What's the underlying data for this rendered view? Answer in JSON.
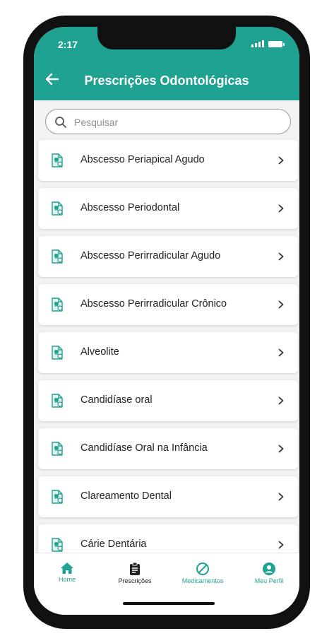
{
  "status_bar": {
    "time": "2:17"
  },
  "header": {
    "title": "Prescrições Odontológicas",
    "back_icon": "arrow-left-icon"
  },
  "search": {
    "placeholder": "Pesquisar",
    "value": ""
  },
  "items": [
    {
      "label": "Abscesso Periapical Agudo"
    },
    {
      "label": "Abscesso Periodontal"
    },
    {
      "label": "Abscesso Perirradicular Agudo"
    },
    {
      "label": "Abscesso Perirradicular Crônico"
    },
    {
      "label": "Alveolite"
    },
    {
      "label": "Candidíase oral"
    },
    {
      "label": "Candidíase Oral na Infância"
    },
    {
      "label": "Clareamento Dental"
    },
    {
      "label": "Cárie Dentária"
    }
  ],
  "bottom_nav": [
    {
      "label": "Home",
      "icon": "home-icon",
      "color": "#20a293"
    },
    {
      "label": "Prescrições",
      "icon": "clipboard-icon",
      "color": "#222222"
    },
    {
      "label": "Medicamentos",
      "icon": "prohibited-icon",
      "color": "#20a293"
    },
    {
      "label": "Meu Perfil",
      "icon": "user-icon",
      "color": "#20a293"
    }
  ],
  "colors": {
    "accent": "#20a293",
    "background": "#f2f2f2"
  }
}
